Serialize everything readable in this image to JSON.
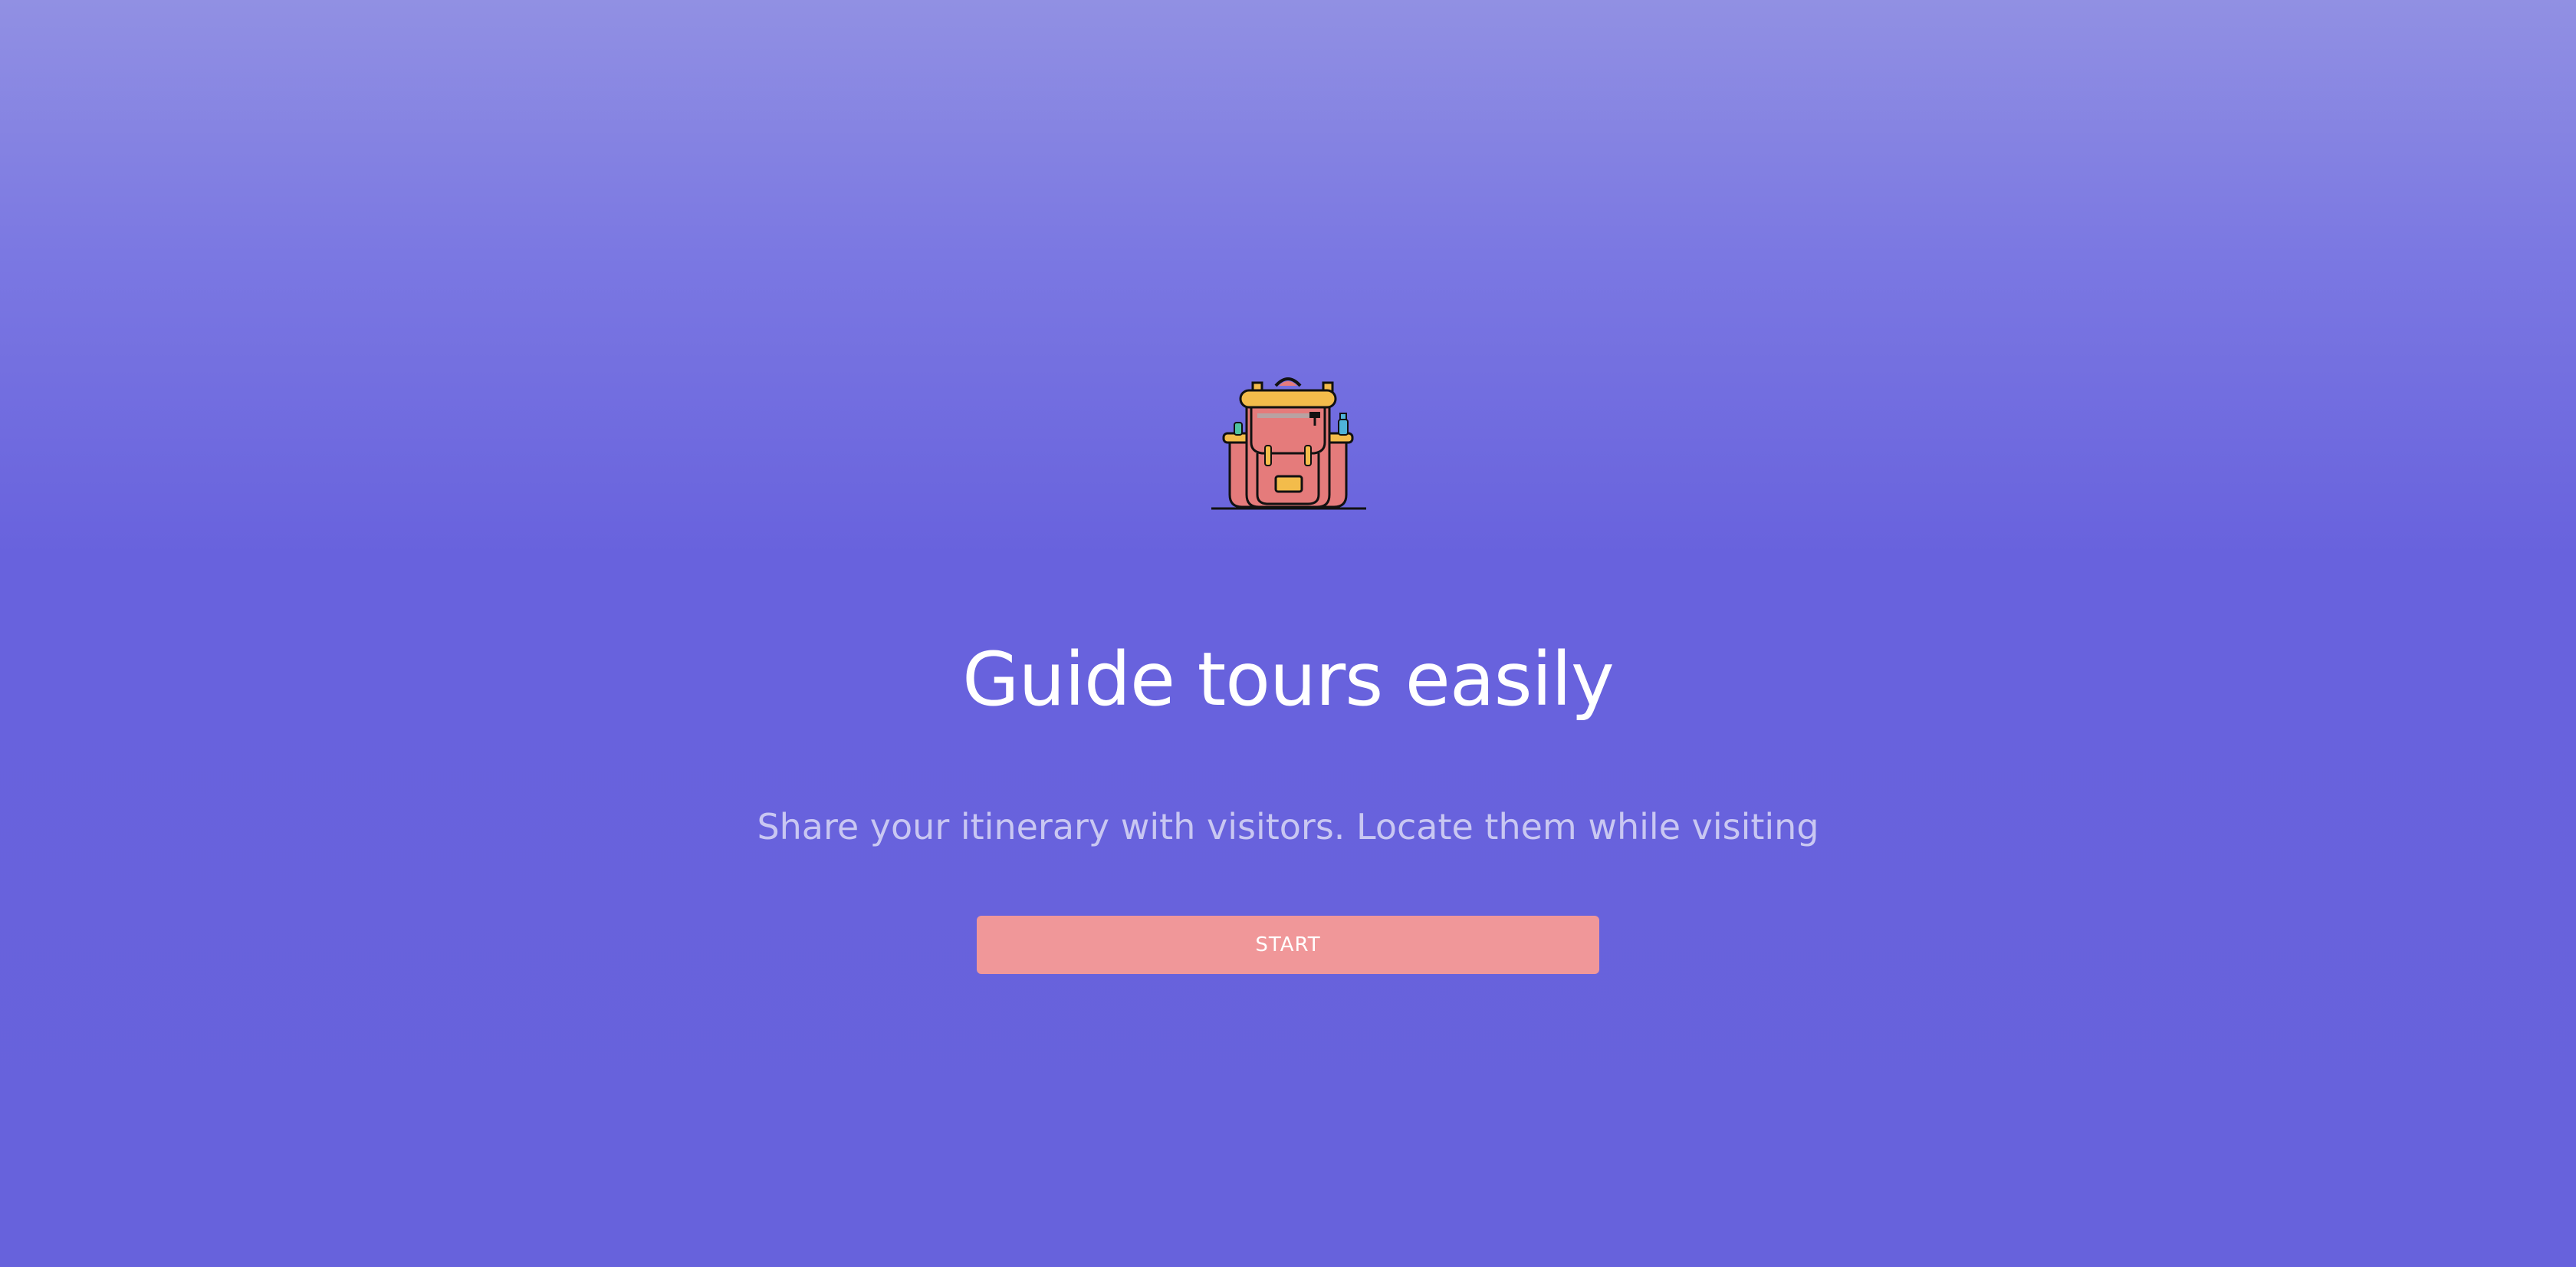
{
  "hero": {
    "logo_icon": "backpack-icon",
    "title": "Guide tours easily",
    "subtitle": "Share your itinerary with visitors. Locate them while visiting",
    "start_label": "START"
  },
  "colors": {
    "background_top": "#9190e3",
    "background_main": "#6762dc",
    "button": "#f09799",
    "title": "#ffffff",
    "subtitle": "#c9c7f2",
    "backpack_body": "#e57b7b",
    "backpack_accent": "#f3bc4b"
  }
}
